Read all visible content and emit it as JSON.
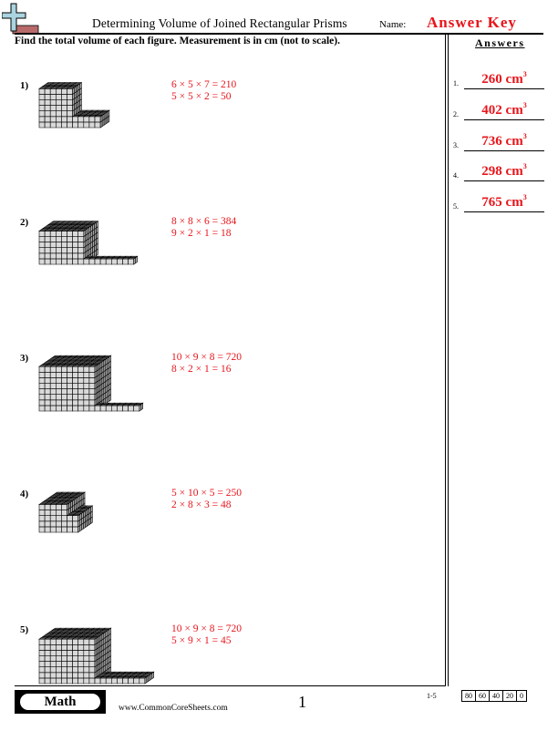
{
  "header": {
    "title": "Determining Volume of Joined Rectangular Prisms",
    "name_label": "Name:",
    "name_value": "Answer Key",
    "logo": "plus-sign-logo-icon"
  },
  "instructions": "Find the total volume of each figure. Measurement is in cm (not to scale).",
  "answers": {
    "title": "Answers",
    "items": [
      {
        "num": "1.",
        "value": "260 cm",
        "unit_exp": "3"
      },
      {
        "num": "2.",
        "value": "402 cm",
        "unit_exp": "3"
      },
      {
        "num": "3.",
        "value": "736 cm",
        "unit_exp": "3"
      },
      {
        "num": "4.",
        "value": "298 cm",
        "unit_exp": "3"
      },
      {
        "num": "5.",
        "value": "765 cm",
        "unit_exp": "3"
      }
    ]
  },
  "problems": [
    {
      "label": "1)",
      "calc": [
        "6 × 5 × 7 = 210",
        "5 × 5 × 2 = 50"
      ],
      "prisms": [
        {
          "w": 6,
          "d": 5,
          "h": 7,
          "x": 0
        },
        {
          "w": 5,
          "d": 5,
          "h": 2,
          "x": 6
        }
      ]
    },
    {
      "label": "2)",
      "calc": [
        "8 × 8 × 6 = 384",
        "9 × 2 × 1 = 18"
      ],
      "prisms": [
        {
          "w": 8,
          "d": 8,
          "h": 6,
          "x": 0
        },
        {
          "w": 9,
          "d": 2,
          "h": 1,
          "x": 8
        }
      ]
    },
    {
      "label": "3)",
      "calc": [
        "10 × 9 × 8 = 720",
        "8 × 2 × 1 = 16"
      ],
      "prisms": [
        {
          "w": 10,
          "d": 9,
          "h": 8,
          "x": 0
        },
        {
          "w": 8,
          "d": 2,
          "h": 1,
          "x": 10
        }
      ]
    },
    {
      "label": "4)",
      "calc": [
        "5 × 10 × 5 = 250",
        "2 × 8 × 3 = 48"
      ],
      "prisms": [
        {
          "w": 5,
          "d": 10,
          "h": 5,
          "x": 0
        },
        {
          "w": 2,
          "d": 8,
          "h": 3,
          "x": 5
        }
      ]
    },
    {
      "label": "5)",
      "calc": [
        "10 × 9 × 8 = 720",
        "5 × 9 × 1 = 45"
      ],
      "prisms": [
        {
          "w": 10,
          "d": 9,
          "h": 8,
          "x": 0
        },
        {
          "w": 9,
          "d": 5,
          "h": 1,
          "x": 10
        }
      ]
    }
  ],
  "footer": {
    "subject": "Math",
    "site": "www.CommonCoreSheets.com",
    "page": "1",
    "score_label": "1-5",
    "scores": [
      "80",
      "60",
      "40",
      "20",
      "0"
    ]
  },
  "colors": {
    "answer_red": "#e8151b",
    "cube_front": "#d9d9d9",
    "cube_side": "#a8a8a8",
    "cube_top": "#6e6e6e",
    "logo_blue": "#a9d4e0",
    "logo_brown": "#b86a6a"
  }
}
